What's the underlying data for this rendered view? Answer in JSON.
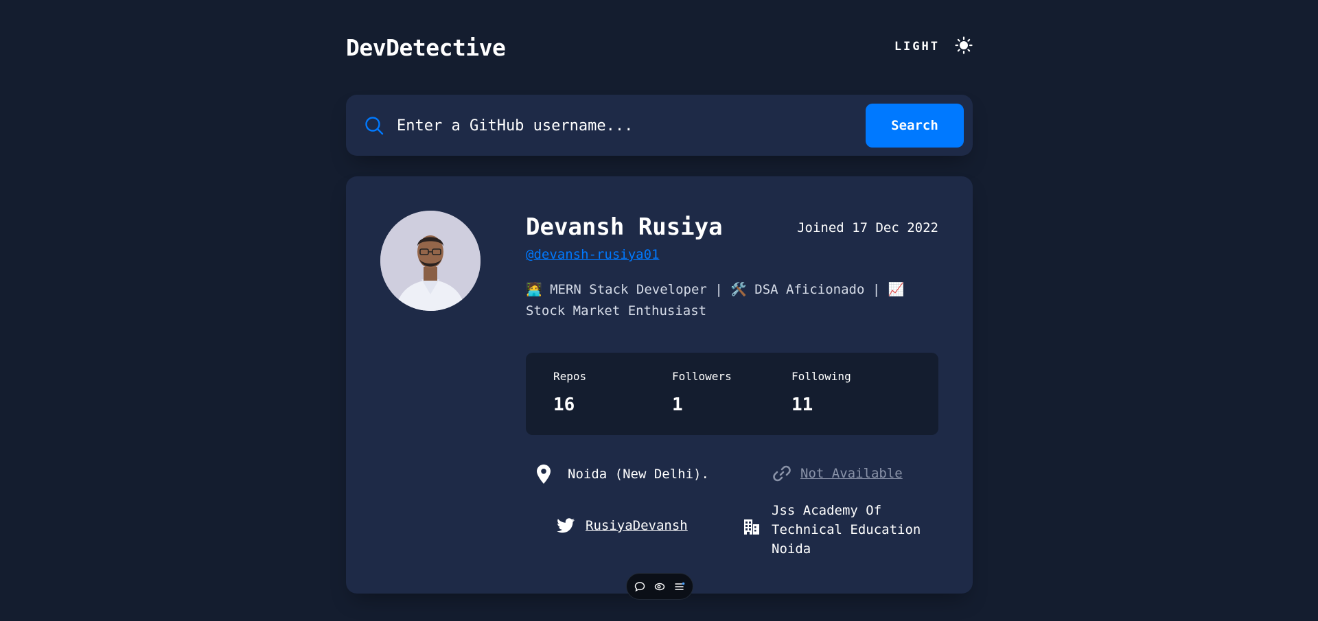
{
  "app": {
    "title": "DevDetective",
    "mode_label": "LIGHT",
    "mode_icon": "sun-icon"
  },
  "search": {
    "placeholder": "Enter a GitHub username...",
    "button_label": "Search",
    "icon": "search-icon"
  },
  "profile": {
    "name": "Devansh Rusiya",
    "joined": "Joined 17 Dec 2022",
    "handle": "@devansh-rusiya01",
    "bio": "🧑‍💻 MERN Stack Developer | 🛠️ DSA Aficionado | 📈 Stock Market Enthusiast",
    "avatar_icon": "avatar"
  },
  "stats": [
    {
      "label": "Repos",
      "value": "16"
    },
    {
      "label": "Followers",
      "value": "1"
    },
    {
      "label": "Following",
      "value": "11"
    }
  ],
  "info": {
    "location": "Noida (New Delhi).",
    "website": "Not Available",
    "twitter": "RusiyaDevansh",
    "company": "Jss Academy Of Technical Education Noida"
  },
  "colors": {
    "background": "#141d2f",
    "card": "#1e2a47",
    "accent": "#0079ff",
    "muted": "#8a93a8"
  }
}
